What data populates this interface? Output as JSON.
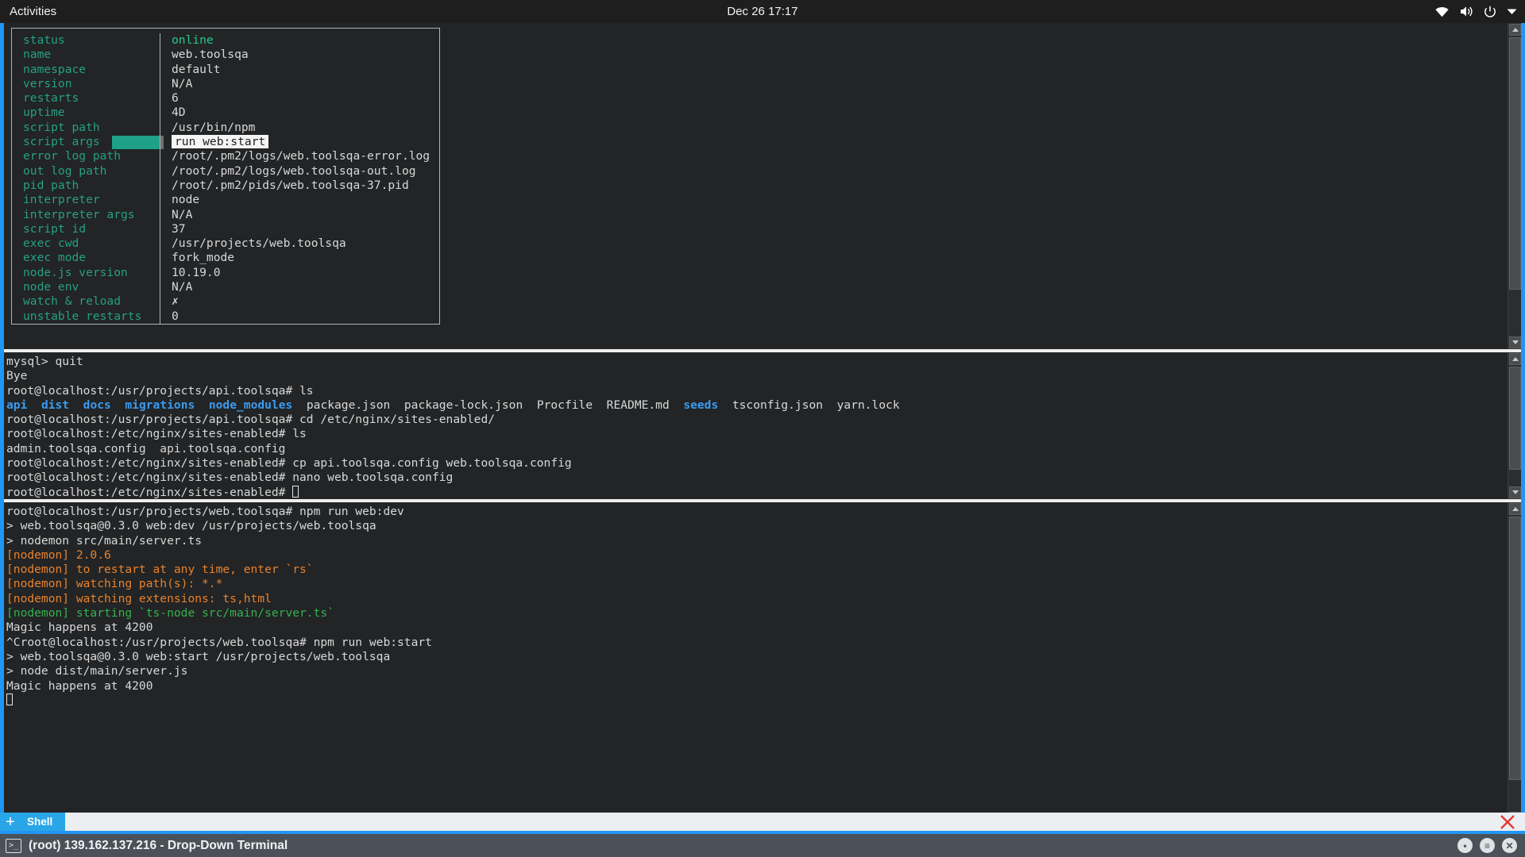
{
  "topbar": {
    "activities": "Activities",
    "clock": "Dec 26  17:17",
    "icons": [
      "wifi-icon",
      "volume-icon",
      "power-icon",
      "chevron-down-icon"
    ]
  },
  "pm2_panel": {
    "rows": [
      {
        "key": "status",
        "value": "online",
        "value_style": "green"
      },
      {
        "key": "name",
        "value": "web.toolsqa"
      },
      {
        "key": "namespace",
        "value": "default"
      },
      {
        "key": "version",
        "value": "N/A"
      },
      {
        "key": "restarts",
        "value": "6"
      },
      {
        "key": "uptime",
        "value": "4D"
      },
      {
        "key": "script path",
        "value": "/usr/bin/npm"
      },
      {
        "key": "script args",
        "value": "run web:start",
        "value_style": "highlight",
        "key_selected": true
      },
      {
        "key": "error log path",
        "value": "/root/.pm2/logs/web.toolsqa-error.log"
      },
      {
        "key": "out log path",
        "value": "/root/.pm2/logs/web.toolsqa-out.log"
      },
      {
        "key": "pid path",
        "value": "/root/.pm2/pids/web.toolsqa-37.pid"
      },
      {
        "key": "interpreter",
        "value": "node"
      },
      {
        "key": "interpreter args",
        "value": "N/A"
      },
      {
        "key": "script id",
        "value": "37"
      },
      {
        "key": "exec cwd",
        "value": "/usr/projects/web.toolsqa"
      },
      {
        "key": "exec mode",
        "value": "fork_mode"
      },
      {
        "key": "node.js version",
        "value": "10.19.0"
      },
      {
        "key": "node env",
        "value": "N/A"
      },
      {
        "key": "watch & reload",
        "value": "✗"
      },
      {
        "key": "unstable restarts",
        "value": "0"
      }
    ]
  },
  "middle_pane": {
    "lines": [
      {
        "segments": [
          {
            "text": "mysql> quit"
          }
        ]
      },
      {
        "segments": [
          {
            "text": "Bye"
          }
        ]
      },
      {
        "segments": [
          {
            "text": "root@localhost:/usr/projects/api.toolsqa# ls"
          }
        ]
      },
      {
        "segments": [
          {
            "text": "api",
            "style": "blue"
          },
          {
            "text": "  "
          },
          {
            "text": "dist",
            "style": "blue"
          },
          {
            "text": "  "
          },
          {
            "text": "docs",
            "style": "blue"
          },
          {
            "text": "  "
          },
          {
            "text": "migrations",
            "style": "blue"
          },
          {
            "text": "  "
          },
          {
            "text": "node_modules",
            "style": "blue"
          },
          {
            "text": "  package.json  package-lock.json  Procfile  README.md  "
          },
          {
            "text": "seeds",
            "style": "blue"
          },
          {
            "text": "  tsconfig.json  yarn.lock"
          }
        ]
      },
      {
        "segments": [
          {
            "text": "root@localhost:/usr/projects/api.toolsqa# cd /etc/nginx/sites-enabled/"
          }
        ]
      },
      {
        "segments": [
          {
            "text": "root@localhost:/etc/nginx/sites-enabled# ls"
          }
        ]
      },
      {
        "segments": [
          {
            "text": "admin.toolsqa.config  api.toolsqa.config"
          }
        ]
      },
      {
        "segments": [
          {
            "text": "root@localhost:/etc/nginx/sites-enabled# cp api.toolsqa.config web.toolsqa.config"
          }
        ]
      },
      {
        "segments": [
          {
            "text": "root@localhost:/etc/nginx/sites-enabled# nano web.toolsqa.config"
          }
        ]
      },
      {
        "segments": [
          {
            "text": "root@localhost:/etc/nginx/sites-enabled# "
          },
          {
            "text": "",
            "style": "cursor"
          }
        ]
      }
    ]
  },
  "bottom_pane": {
    "lines": [
      {
        "segments": [
          {
            "text": "root@localhost:/usr/projects/web.toolsqa# npm run web:dev"
          }
        ]
      },
      {
        "segments": [
          {
            "text": ""
          }
        ]
      },
      {
        "segments": [
          {
            "text": "> web.toolsqa@0.3.0 web:dev /usr/projects/web.toolsqa"
          }
        ]
      },
      {
        "segments": [
          {
            "text": "> nodemon src/main/server.ts"
          }
        ]
      },
      {
        "segments": [
          {
            "text": ""
          }
        ]
      },
      {
        "segments": [
          {
            "text": "[nodemon] 2.0.6",
            "style": "orange"
          }
        ]
      },
      {
        "segments": [
          {
            "text": "[nodemon] to restart at any time, enter `rs`",
            "style": "orange"
          }
        ]
      },
      {
        "segments": [
          {
            "text": "[nodemon] watching path(s): *.*",
            "style": "orange"
          }
        ]
      },
      {
        "segments": [
          {
            "text": "[nodemon] watching extensions: ts,html",
            "style": "orange"
          }
        ]
      },
      {
        "segments": [
          {
            "text": "[nodemon] starting `ts-node src/main/server.ts`",
            "style": "green"
          }
        ]
      },
      {
        "segments": [
          {
            "text": "Magic happens at 4200"
          }
        ]
      },
      {
        "segments": [
          {
            "text": "^Croot@localhost:/usr/projects/web.toolsqa# npm run web:start"
          }
        ]
      },
      {
        "segments": [
          {
            "text": ""
          }
        ]
      },
      {
        "segments": [
          {
            "text": "> web.toolsqa@0.3.0 web:start /usr/projects/web.toolsqa"
          }
        ]
      },
      {
        "segments": [
          {
            "text": "> node dist/main/server.js"
          }
        ]
      },
      {
        "segments": [
          {
            "text": ""
          }
        ]
      },
      {
        "segments": [
          {
            "text": "Magic happens at 4200"
          }
        ]
      },
      {
        "segments": [
          {
            "text": "",
            "style": "cursor"
          }
        ]
      }
    ]
  },
  "tabbar": {
    "new_tab_label": "+",
    "tabs": [
      {
        "label": "Shell"
      }
    ],
    "close_label": "✕"
  },
  "taskbar": {
    "icon": "terminal-icon",
    "title": "(root) 139.162.137.216 - Drop-Down Terminal",
    "buttons": [
      "minimize-icon",
      "menu-icon",
      "close-icon"
    ]
  },
  "colors": {
    "accent_blue": "#2196f3",
    "tab_blue": "#29a6e8",
    "pm2_key_teal": "#26a083",
    "pm2_status_green": "#25c98c",
    "selection_teal": "#1ea188",
    "dir_blue": "#3b9bf0",
    "nodemon_orange": "#e8822b",
    "nodemon_green": "#37b24d",
    "terminal_bg": "#222426",
    "taskbar_bg": "#4a5159"
  }
}
